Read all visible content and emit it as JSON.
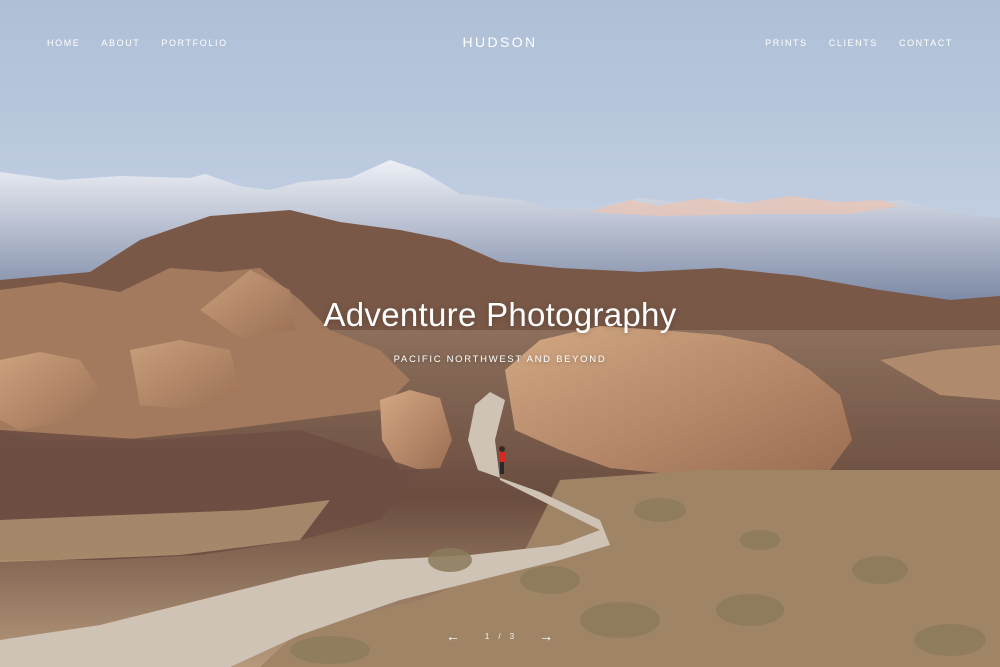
{
  "brand": "HUDSON",
  "nav": {
    "left": [
      "HOME",
      "ABOUT",
      "PORTFOLIO"
    ],
    "right": [
      "PRINTS",
      "CLIENTS",
      "CONTACT"
    ]
  },
  "hero": {
    "title": "Adventure Photography",
    "subtitle": "PACIFIC NORTHWEST AND BEYOND"
  },
  "pager": {
    "prev_icon": "arrow-left-icon",
    "next_icon": "arrow-right-icon",
    "current": "1",
    "separator": "/",
    "total": "3"
  }
}
